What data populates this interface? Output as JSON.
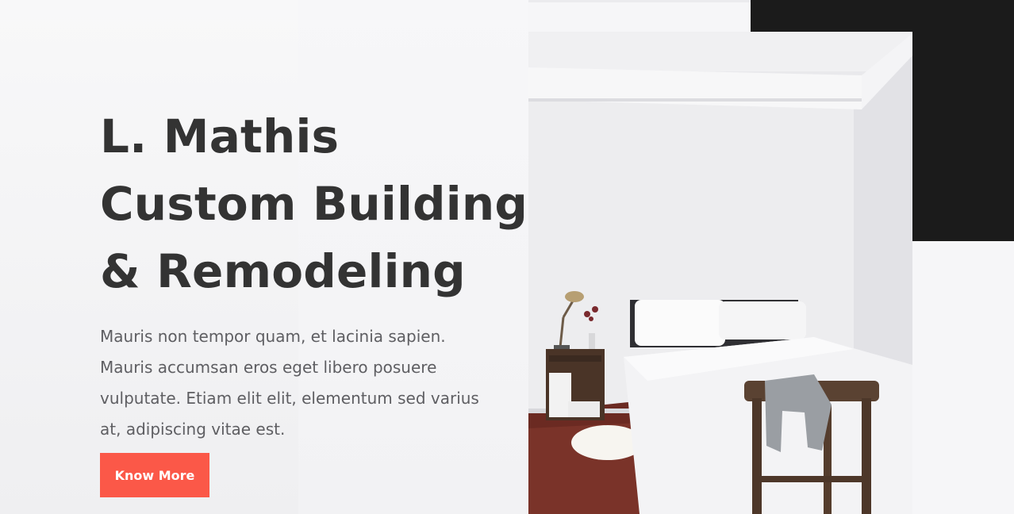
{
  "hero": {
    "title_lines": [
      "L. Mathis",
      "Custom Building",
      "& Remodeling"
    ],
    "description": "Mauris non tempor quam, et lacinia sapien. Mauris accumsan eros eget libero posuere vulputate. Etiam elit elit, elementum sed varius at, adipiscing vitae est.",
    "cta_label": "Know More"
  },
  "colors": {
    "accent": "#fb5848",
    "dark_block": "#1b1b1b",
    "heading": "#333333",
    "body_text": "#5e5e62",
    "background": "#f6f6f8"
  },
  "image": {
    "subject": "bedroom-interior-photo"
  }
}
